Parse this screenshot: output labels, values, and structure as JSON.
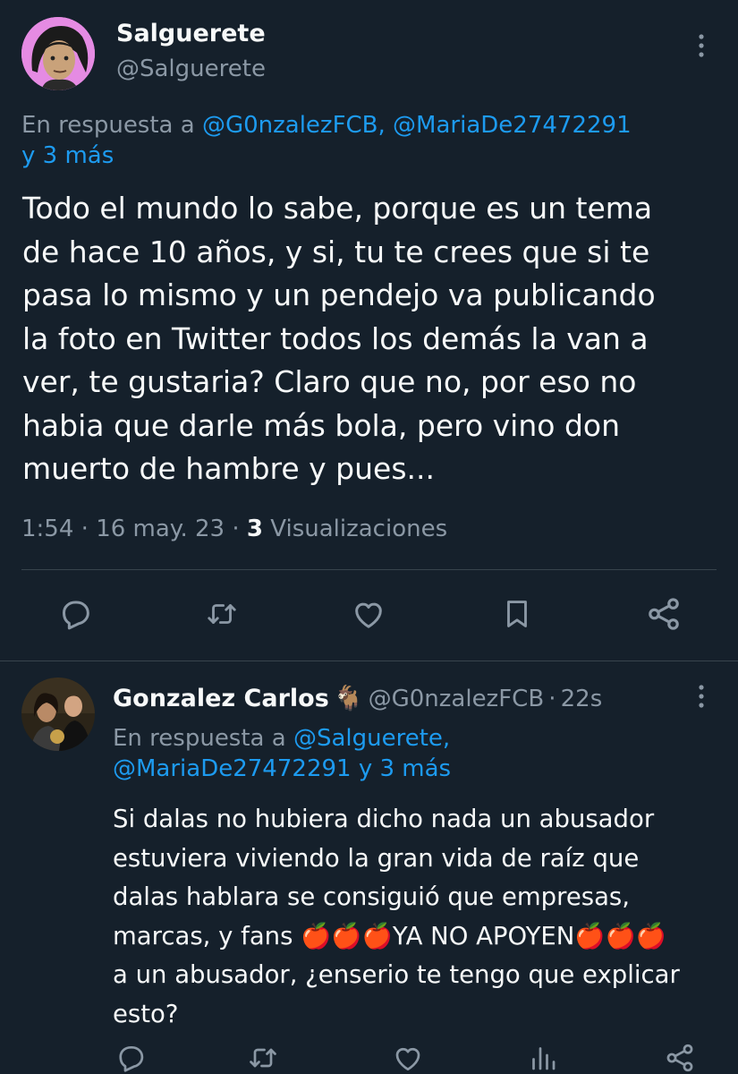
{
  "main_tweet": {
    "author_name": "Salguerete",
    "author_handle": "@Salguerete",
    "reply_prefix": "En respuesta a ",
    "reply_mentions_line1": "@G0nzalezFCB, @MariaDe27472291",
    "reply_more": "y 3 más",
    "text_lines": [
      "Todo el mundo lo sabe, porque es un tema",
      "de hace 10 años, y si, tu te crees que si te",
      "pasa lo mismo y un pendejo va publicando",
      "la foto en Twitter todos los demás la van a",
      "ver, te gustaria? Claro que no, por eso no",
      "habia que darle más bola, pero vino don",
      "muerto de hambre y pues..."
    ],
    "time": "1:54",
    "date": "16 may. 23",
    "views_count": "3",
    "views_label": "Visualizaciones"
  },
  "reply_tweet": {
    "author_name": "Gonzalez Carlos",
    "name_emoji": "🐐",
    "author_handle": "@G0nzalezFCB",
    "age": "22s",
    "reply_prefix": "En respuesta a ",
    "reply_mention1": "@Salguerete,",
    "reply_mention2": "@MariaDe27472291",
    "reply_more": "y 3 más",
    "text_lines": [
      "Si dalas no hubiera dicho nada un abusador",
      "estuviera viviendo la gran vida de raíz que",
      "dalas hablara se consiguió que empresas,",
      "a un abusador, ¿enserio te tengo que explicar",
      "esto?"
    ],
    "line4_prefix": "marcas, y fans ",
    "apples_left": "🍎🍎🍎",
    "line4_caps": "YA NO APOYEN",
    "apples_right": "🍎🍎🍎"
  },
  "icons": [
    "more-vertical",
    "reply",
    "retweet",
    "like",
    "bookmark",
    "share",
    "views"
  ],
  "colors": {
    "background": "#15202b",
    "text": "#f7f9f9",
    "secondary": "#8b98a5",
    "link": "#1d9bf0",
    "avatar_ring": "#e07be0"
  }
}
